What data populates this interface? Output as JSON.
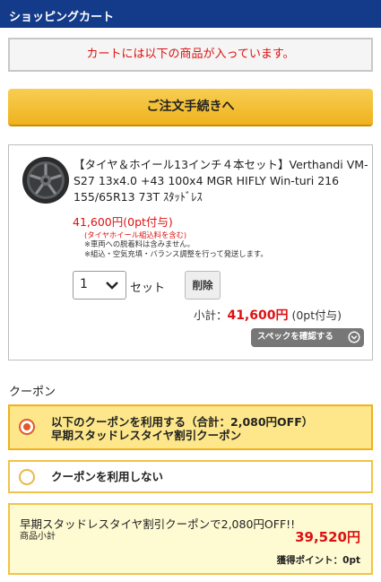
{
  "header": {
    "title": "ショッピングカート"
  },
  "notice": {
    "text": "カートには以下の商品が入っています。"
  },
  "checkout": {
    "label": "ご注文手続きへ"
  },
  "product": {
    "title": "【タイヤ＆ホイール13インチ４本セット】Verthandi VM-S27 13x4.0 +43 100x4 MGR HIFLY Win-turi 216 155/65R13 73T ｽﾀｯﾄﾞﾚｽ",
    "price": "41,600円(0pt付与)",
    "note_red": "(タイヤホイール組込料を含む)",
    "note1": "※車両への脱着料は含みません。",
    "note2": "※組込・空気充填・バランス調整を行って発送します。",
    "quantity": "1",
    "unit": "セット",
    "delete_label": "削除",
    "subtotal_label": "小計：",
    "subtotal_amount": "41,600円",
    "subtotal_points": " (0pt付与)",
    "spec_label": "スペックを確認する"
  },
  "coupon": {
    "heading": "クーポン",
    "option_use_line1": "以下のクーポンを利用する（合計：2,080円OFF）",
    "option_use_line2": "早期スタッドレスタイヤ割引クーポン",
    "option_none": "クーポンを利用しない"
  },
  "summary": {
    "message": "早期スタッドレスタイヤ割引クーポンで2,080円OFF!!",
    "subtotal_label": "商品小計",
    "subtotal_value": "39,520円",
    "points_label": "獲得ポイント：",
    "points_value": "0pt"
  },
  "colors": {
    "header": "#143a8a",
    "accent_red": "#dd1111",
    "button_gold": "#efb21e"
  },
  "icons": [
    "wheel-image",
    "chevron-down-icon",
    "circle-chevron-down-icon",
    "radio-selected-icon",
    "radio-unselected-icon"
  ]
}
